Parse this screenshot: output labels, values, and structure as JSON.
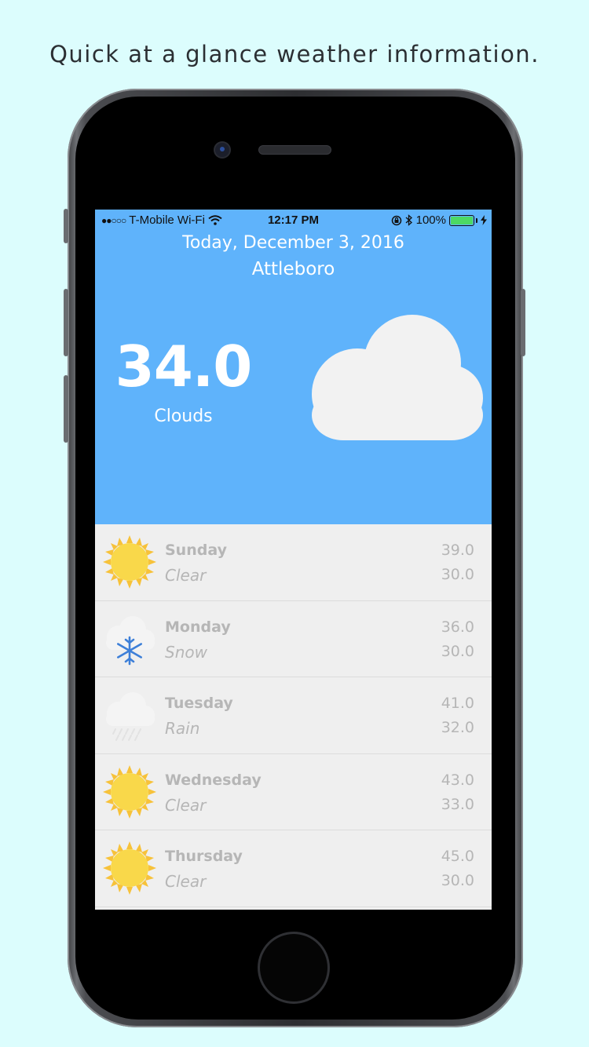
{
  "caption": "Quick at a glance weather information.",
  "status_bar": {
    "carrier": "T-Mobile Wi-Fi",
    "time": "12:17 PM",
    "battery": "100%"
  },
  "header": {
    "date": "Today, December 3, 2016",
    "city": "Attleboro",
    "temperature": "34.0",
    "condition": "Clouds",
    "icon": "cloud-icon"
  },
  "forecast": [
    {
      "day": "Sunday",
      "description": "Clear",
      "high": "39.0",
      "low": "30.0",
      "icon": "sun-icon"
    },
    {
      "day": "Monday",
      "description": "Snow",
      "high": "36.0",
      "low": "30.0",
      "icon": "snow-icon"
    },
    {
      "day": "Tuesday",
      "description": "Rain",
      "high": "41.0",
      "low": "32.0",
      "icon": "rain-icon"
    },
    {
      "day": "Wednesday",
      "description": "Clear",
      "high": "43.0",
      "low": "33.0",
      "icon": "sun-icon"
    },
    {
      "day": "Thursday",
      "description": "Clear",
      "high": "45.0",
      "low": "30.0",
      "icon": "sun-icon"
    }
  ],
  "colors": {
    "background": "#dcfdfd",
    "header": "#5fb3fb",
    "list": "#efefef",
    "sun": "#f9d84a",
    "snowflake": "#3d7fd8"
  }
}
